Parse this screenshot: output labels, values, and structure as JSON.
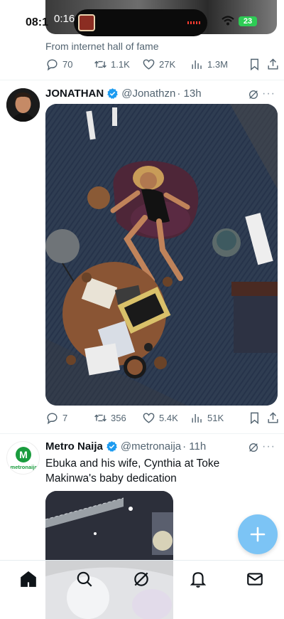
{
  "status_bar": {
    "time": "08:1",
    "live_activity_time": "0:16",
    "battery": "23"
  },
  "previous_tweet": {
    "caption": "From internet hall of fame",
    "replies": "70",
    "retweets": "1.1K",
    "likes": "27K",
    "views": "1.3M"
  },
  "tweet1": {
    "name": "JONATHAN",
    "handle": "@Jonathzn",
    "time": "· 13h",
    "replies": "7",
    "retweets": "356",
    "likes": "5.4K",
    "views": "51K"
  },
  "tweet2": {
    "name": "Metro Naija",
    "handle": "@metronaija",
    "time": "· 11h",
    "avatar_label": "metronaija",
    "avatar_letter": "M",
    "text": "Ebuka and his wife, Cynthia at Toke Makinwa's baby dedication"
  },
  "more_label": "···",
  "colors": {
    "accent": "#1d9bf0",
    "fab": "#7cc4f5",
    "metronaija": "#1a9c3e"
  },
  "nav_icons": [
    "home-icon",
    "search-icon",
    "grok-icon",
    "notifications-icon",
    "messages-icon"
  ]
}
